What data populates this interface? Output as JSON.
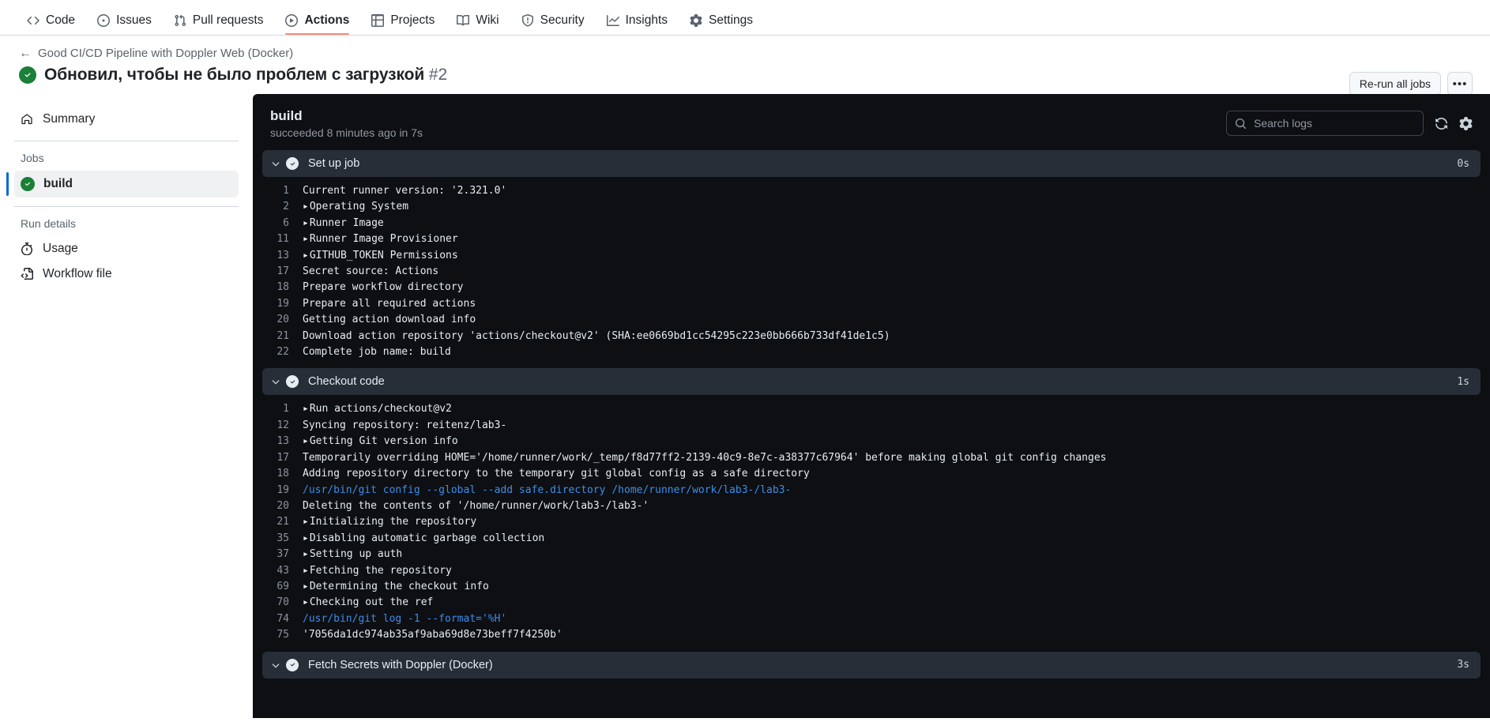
{
  "repo_nav": [
    {
      "label": "Code",
      "icon": "code-icon",
      "active": false
    },
    {
      "label": "Issues",
      "icon": "issue-opened-icon",
      "active": false
    },
    {
      "label": "Pull requests",
      "icon": "git-pull-request-icon",
      "active": false
    },
    {
      "label": "Actions",
      "icon": "play-circle-icon",
      "active": true
    },
    {
      "label": "Projects",
      "icon": "table-icon",
      "active": false
    },
    {
      "label": "Wiki",
      "icon": "book-icon",
      "active": false
    },
    {
      "label": "Security",
      "icon": "shield-icon",
      "active": false
    },
    {
      "label": "Insights",
      "icon": "graph-icon",
      "active": false
    },
    {
      "label": "Settings",
      "icon": "gear-icon",
      "active": false
    }
  ],
  "run_header": {
    "breadcrumb": "Good CI/CD Pipeline with Doppler Web (Docker)",
    "title": "Обновил, чтобы не было проблем с загрузкой",
    "run_number": "#2",
    "status_icon": "check-circle-fill-icon",
    "rerun_label": "Re-run all jobs",
    "kebab_label": "•••"
  },
  "sidebar": {
    "summary_label": "Summary",
    "summary_icon": "home-icon",
    "jobs_heading": "Jobs",
    "jobs": [
      {
        "label": "build",
        "status_icon": "check-circle-fill-icon",
        "selected": true
      }
    ],
    "run_details_heading": "Run details",
    "details": [
      {
        "label": "Usage",
        "icon": "stopwatch-icon"
      },
      {
        "label": "Workflow file",
        "icon": "file-code-icon"
      }
    ]
  },
  "log_panel": {
    "job_name": "build",
    "job_status": "succeeded 8 minutes ago in 7s",
    "search_placeholder": "Search logs",
    "search_value": "",
    "search_icon": "search-icon",
    "refresh_icon": "sync-icon",
    "settings_icon": "gear-icon",
    "groups": [
      {
        "title": "Set up job",
        "duration": "0s",
        "status_icon": "check-circle-fill-icon",
        "expanded": true,
        "lines": [
          {
            "n": "1",
            "text": "Current runner version: '2.321.0'",
            "collapsible": false,
            "cmd": false
          },
          {
            "n": "2",
            "text": "Operating System",
            "collapsible": true,
            "cmd": false
          },
          {
            "n": "6",
            "text": "Runner Image",
            "collapsible": true,
            "cmd": false
          },
          {
            "n": "11",
            "text": "Runner Image Provisioner",
            "collapsible": true,
            "cmd": false
          },
          {
            "n": "13",
            "text": "GITHUB_TOKEN Permissions",
            "collapsible": true,
            "cmd": false
          },
          {
            "n": "17",
            "text": "Secret source: Actions",
            "collapsible": false,
            "cmd": false
          },
          {
            "n": "18",
            "text": "Prepare workflow directory",
            "collapsible": false,
            "cmd": false
          },
          {
            "n": "19",
            "text": "Prepare all required actions",
            "collapsible": false,
            "cmd": false
          },
          {
            "n": "20",
            "text": "Getting action download info",
            "collapsible": false,
            "cmd": false
          },
          {
            "n": "21",
            "text": "Download action repository 'actions/checkout@v2' (SHA:ee0669bd1cc54295c223e0bb666b733df41de1c5)",
            "collapsible": false,
            "cmd": false
          },
          {
            "n": "22",
            "text": "Complete job name: build",
            "collapsible": false,
            "cmd": false
          }
        ]
      },
      {
        "title": "Checkout code",
        "duration": "1s",
        "status_icon": "check-circle-fill-icon",
        "expanded": true,
        "lines": [
          {
            "n": "1",
            "text": "Run actions/checkout@v2",
            "collapsible": true,
            "cmd": false
          },
          {
            "n": "12",
            "text": "Syncing repository: reitenz/lab3-",
            "collapsible": false,
            "cmd": false
          },
          {
            "n": "13",
            "text": "Getting Git version info",
            "collapsible": true,
            "cmd": false
          },
          {
            "n": "17",
            "text": "Temporarily overriding HOME='/home/runner/work/_temp/f8d77ff2-2139-40c9-8e7c-a38377c67964' before making global git config changes",
            "collapsible": false,
            "cmd": false
          },
          {
            "n": "18",
            "text": "Adding repository directory to the temporary git global config as a safe directory",
            "collapsible": false,
            "cmd": false
          },
          {
            "n": "19",
            "text": "/usr/bin/git config --global --add safe.directory /home/runner/work/lab3-/lab3-",
            "collapsible": false,
            "cmd": true
          },
          {
            "n": "20",
            "text": "Deleting the contents of '/home/runner/work/lab3-/lab3-'",
            "collapsible": false,
            "cmd": false
          },
          {
            "n": "21",
            "text": "Initializing the repository",
            "collapsible": true,
            "cmd": false
          },
          {
            "n": "35",
            "text": "Disabling automatic garbage collection",
            "collapsible": true,
            "cmd": false
          },
          {
            "n": "37",
            "text": "Setting up auth",
            "collapsible": true,
            "cmd": false
          },
          {
            "n": "43",
            "text": "Fetching the repository",
            "collapsible": true,
            "cmd": false
          },
          {
            "n": "69",
            "text": "Determining the checkout info",
            "collapsible": true,
            "cmd": false
          },
          {
            "n": "70",
            "text": "Checking out the ref",
            "collapsible": true,
            "cmd": false
          },
          {
            "n": "74",
            "text": "/usr/bin/git log -1 --format='%H'",
            "collapsible": false,
            "cmd": true
          },
          {
            "n": "75",
            "text": "'7056da1dc974ab35af9aba69d8e73beff7f4250b'",
            "collapsible": false,
            "cmd": false
          }
        ]
      },
      {
        "title": "Fetch Secrets with Doppler (Docker)",
        "duration": "3s",
        "status_icon": "check-circle-fill-icon",
        "expanded": false,
        "lines": []
      }
    ]
  },
  "colors": {
    "accent": "#0969da",
    "success": "#1a7f37",
    "active_tab_underline": "#fd8c73",
    "log_bg": "#0d0f13",
    "group_bg": "#272e38",
    "cmd_blue": "#3b8eea"
  }
}
